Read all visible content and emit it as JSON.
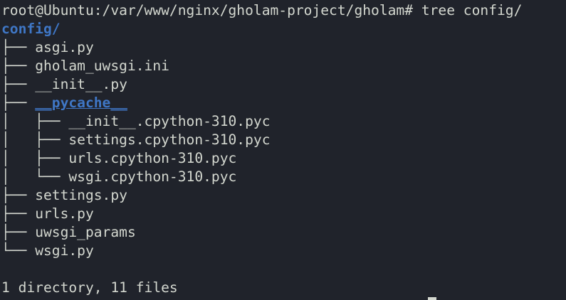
{
  "terminal": {
    "prompt": "root@Ubuntu:/var/www/nginx/gholam-project/gholam#",
    "command": "tree config/",
    "root_dir": "config/",
    "entries": [
      {
        "prefix": "├── ",
        "name": "asgi.py",
        "type": "file"
      },
      {
        "prefix": "├── ",
        "name": "gholam_uwsgi.ini",
        "type": "file"
      },
      {
        "prefix": "├── ",
        "name": "__init__.py",
        "type": "file"
      },
      {
        "prefix": "├── ",
        "name": "__pycache__",
        "type": "dir"
      },
      {
        "prefix": "│   ├── ",
        "name": "__init__.cpython-310.pyc",
        "type": "file"
      },
      {
        "prefix": "│   ├── ",
        "name": "settings.cpython-310.pyc",
        "type": "file"
      },
      {
        "prefix": "│   ├── ",
        "name": "urls.cpython-310.pyc",
        "type": "file"
      },
      {
        "prefix": "│   └── ",
        "name": "wsgi.cpython-310.pyc",
        "type": "file"
      },
      {
        "prefix": "├── ",
        "name": "settings.py",
        "type": "file"
      },
      {
        "prefix": "├── ",
        "name": "urls.py",
        "type": "file"
      },
      {
        "prefix": "├── ",
        "name": "uwsgi_params",
        "type": "file"
      },
      {
        "prefix": "└── ",
        "name": "wsgi.py",
        "type": "file"
      }
    ],
    "summary": "1 directory, 11 files",
    "colors": {
      "background": "#20232b",
      "text": "#d3d7cf",
      "directory": "#3f77c6"
    }
  }
}
